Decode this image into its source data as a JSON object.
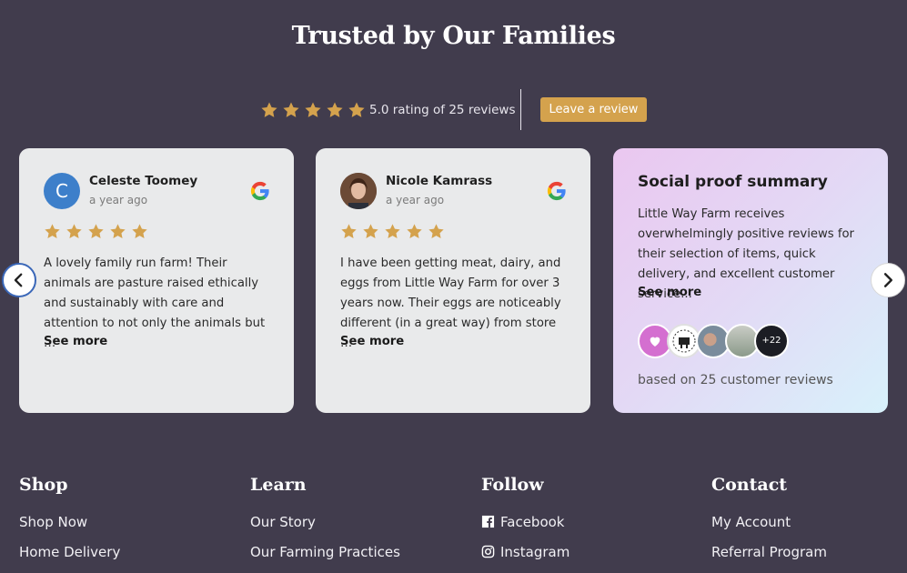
{
  "heading": "Trusted by Our Families",
  "rating": {
    "stars": 5,
    "text": "5.0 rating of 25 reviews",
    "cta_label": "Leave a review"
  },
  "colors": {
    "background": "#413c4d",
    "star": "#d4a24d",
    "button": "#d4a24d",
    "card": "#e9eaeb"
  },
  "reviews": [
    {
      "name": "Celeste Toomey",
      "time": "a year ago",
      "avatar_letter": "C",
      "stars": 5,
      "text": "A lovely family run farm!  Their animals are pasture raised ethically and sustainably with care and attention to not only the animals but …",
      "see_more": "See more",
      "source_icon": "google-icon"
    },
    {
      "name": "Nicole Kamrass",
      "time": "a year ago",
      "avatar_letter": "",
      "stars": 5,
      "text": "I have been getting meat, dairy, and eggs from Little Way Farm for over 3 years now. Their eggs are noticeably different (in a great way) from store …",
      "see_more": "See more",
      "source_icon": "google-icon"
    }
  ],
  "summary": {
    "title": "Social proof summary",
    "text": "Little Way Farm receives overwhelmingly positive reviews for their selection of items, quick delivery, and excellent customer service...",
    "see_more": "See more",
    "more_count": "+22",
    "footer": "based on 25 customer reviews"
  },
  "footer": {
    "shop": {
      "heading": "Shop",
      "links": [
        "Shop Now",
        "Home Delivery"
      ]
    },
    "learn": {
      "heading": "Learn",
      "links": [
        "Our Story",
        "Our Farming Practices"
      ]
    },
    "follow": {
      "heading": "Follow",
      "links": [
        "Facebook",
        "Instagram"
      ]
    },
    "contact": {
      "heading": "Contact",
      "links": [
        "My Account",
        "Referral Program"
      ]
    }
  }
}
